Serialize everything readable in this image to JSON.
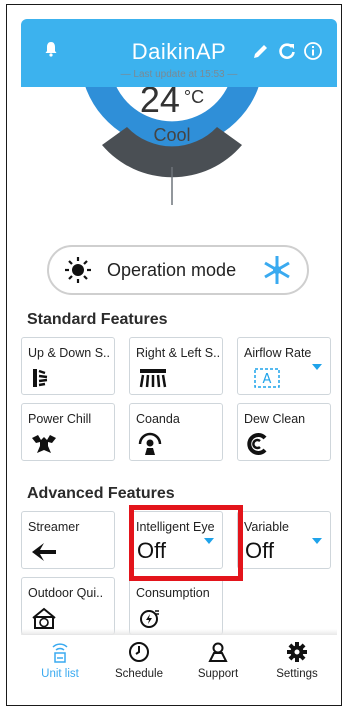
{
  "header": {
    "title": "DaikinAP",
    "last_update": "Last update at 15:53",
    "icons": [
      "bell-icon",
      "pencil-icon",
      "refresh-icon",
      "info-icon"
    ]
  },
  "dial": {
    "temperature": "24",
    "unit": "°C",
    "mode": "Cool",
    "minus_label": "−",
    "plus_label": "+"
  },
  "operation_mode": {
    "label": "Operation mode"
  },
  "standard_features": {
    "title": "Standard Features",
    "items": [
      {
        "label": "Up & Down S..",
        "icon": "vertical-swing-icon"
      },
      {
        "label": "Right & Left S..",
        "icon": "horizontal-swing-icon"
      },
      {
        "label": "Airflow Rate",
        "icon": "airflow-auto-icon"
      },
      {
        "label": "Power Chill",
        "icon": "power-chill-icon"
      },
      {
        "label": "Coanda",
        "icon": "coanda-icon"
      },
      {
        "label": "Dew Clean",
        "icon": "dew-clean-icon"
      }
    ]
  },
  "advanced_features": {
    "title": "Advanced Features",
    "items": [
      {
        "label": "Streamer",
        "icon": "streamer-icon"
      },
      {
        "label": "Intelligent Eye",
        "value": "Off"
      },
      {
        "label": "Variable",
        "value": "Off"
      },
      {
        "label": "Outdoor Qui..",
        "icon": "outdoor-quiet-icon"
      },
      {
        "label": "Consumption",
        "icon": "consumption-icon"
      }
    ]
  },
  "bottom_nav": {
    "items": [
      {
        "label": "Unit list",
        "icon": "unit-list-icon",
        "active": true
      },
      {
        "label": "Schedule",
        "icon": "clock-icon"
      },
      {
        "label": "Support",
        "icon": "support-icon"
      },
      {
        "label": "Settings",
        "icon": "gear-icon"
      }
    ]
  },
  "colors": {
    "accent": "#3cb2ee",
    "dial_blue": "#2f8fd8",
    "dial_dark": "#4a4f54",
    "highlight": "#e3141b",
    "active_nav": "#3aaaf0"
  }
}
